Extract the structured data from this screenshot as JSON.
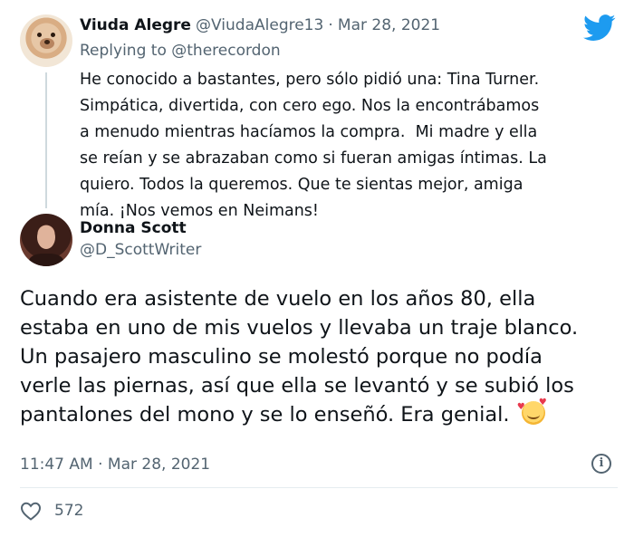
{
  "reply_tweet": {
    "author_name": "Viuda Alegre",
    "author_handle": "@ViudaAlegre13",
    "date_separator": "·",
    "date": "Mar 28, 2021",
    "replying_prefix": "Replying to",
    "replying_handle": "@therecordon",
    "lines": [
      "He conocido a bastantes, pero sólo pidió una: Tina Turner.",
      "Simpática, divertida, con cero ego. Nos la encontrábamos",
      "a menudo mientras hacíamos la compra.  Mi madre y ella",
      "se reían y se abrazaban como si fueran amigas íntimas. La",
      "quiero. Todos la queremos. Que te sientas mejor, amiga",
      "mía. ¡Nos vemos en Neimans!"
    ]
  },
  "main_tweet": {
    "author_name": "Donna Scott",
    "author_handle": "@D_ScottWriter",
    "lines": [
      "Cuando era asistente de vuelo en los años 80, ella",
      "estaba en uno de mis vuelos y llevaba un traje blanco.",
      "Un pasajero masculino se molestó porque no podía",
      "verle las piernas, así que ella se levantó y se subió los",
      "pantalones del mono y se lo enseñó. Era genial."
    ],
    "emoji_icon": "smiling-face-with-hearts-emoji",
    "time": "11:47 AM",
    "date_separator": "·",
    "date": "Mar 28, 2021",
    "like_count": "572"
  },
  "icons": {
    "brand": "twitter-bird-icon",
    "info": "info-icon",
    "like": "heart-outline-icon"
  },
  "colors": {
    "twitter_blue": "#1d9bf0",
    "text_primary": "#0f1419",
    "text_secondary": "#536471",
    "divider": "#e6ecf0"
  }
}
